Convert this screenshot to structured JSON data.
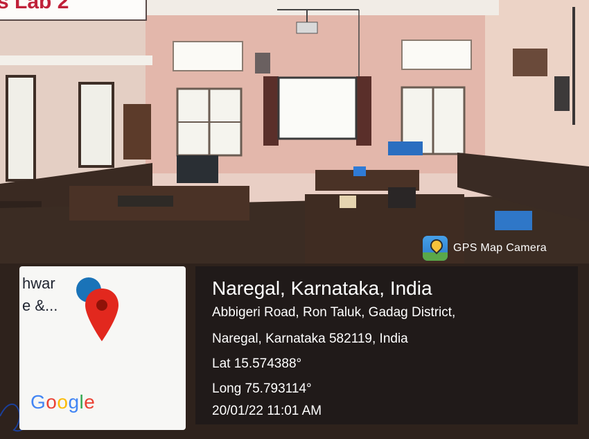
{
  "top_label": {
    "text": "s Lab 2"
  },
  "watermark": {
    "app_name": "GPS Map Camera"
  },
  "map": {
    "partial_line1": "hwar",
    "partial_line2": "e &...",
    "logo": "Google",
    "logo_colors": [
      "#4285F4",
      "#EA4335",
      "#FBBC05",
      "#4285F4",
      "#34A853",
      "#EA4335"
    ]
  },
  "location": {
    "title": "Naregal, Karnataka, India",
    "address_line1": "Abbigeri Road, Ron Taluk, Gadag District,",
    "address_line2": "Naregal, Karnataka 582119, India",
    "lat": "Lat 15.574388°",
    "long": "Long 75.793114°",
    "datetime": "20/01/22 11:01 AM"
  }
}
